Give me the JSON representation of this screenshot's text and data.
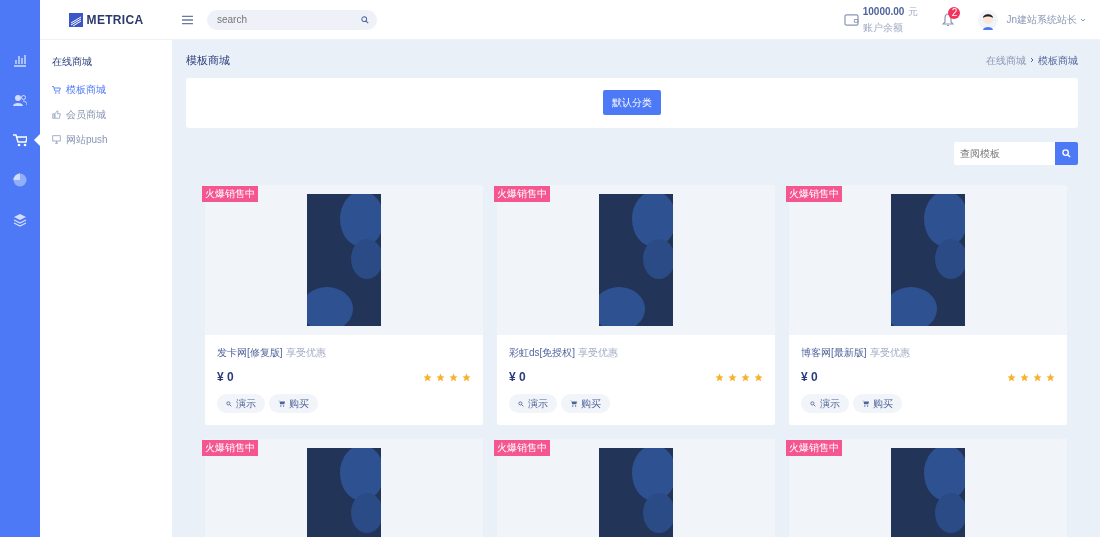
{
  "rail": {
    "items": [
      {
        "selected": false
      },
      {
        "selected": false
      },
      {
        "selected": true
      },
      {
        "selected": false
      },
      {
        "selected": false
      }
    ]
  },
  "header": {
    "logo": "METRICA",
    "search": {
      "placeholder": "search"
    },
    "balance": {
      "amount": "10000.00",
      "unit": "元",
      "label": "账户余额"
    },
    "notifications": "2",
    "user": "Jn建站系统站长"
  },
  "sidebar": {
    "title": "在线商城",
    "items": [
      {
        "label": "模板商城",
        "selected": true
      },
      {
        "label": "会员商城",
        "selected": false
      },
      {
        "label": "网站push",
        "selected": false
      }
    ]
  },
  "page": {
    "title": "模板商城",
    "breadcrumb": [
      "在线商城",
      "模板商城"
    ],
    "category_button": "默认分类",
    "template_search": {
      "placeholder": "查阅模板"
    }
  },
  "cards": [
    {
      "badge": "火爆销售中",
      "name": "发卡网[修复版]",
      "tag": "享受优惠",
      "price": "¥ 0",
      "stars": 4,
      "buttons": [
        "演示",
        "购买"
      ]
    },
    {
      "badge": "火爆销售中",
      "name": "彩虹ds[免授权]",
      "tag": "享受优惠",
      "price": "¥ 0",
      "stars": 4,
      "buttons": [
        "演示",
        "购买"
      ]
    },
    {
      "badge": "火爆销售中",
      "name": "博客网[最新版]",
      "tag": "享受优惠",
      "price": "¥ 0",
      "stars": 4,
      "buttons": [
        "演示",
        "购买"
      ]
    },
    {
      "badge": "火爆销售中"
    },
    {
      "badge": "火爆销售中"
    },
    {
      "badge": "火爆销售中"
    }
  ]
}
